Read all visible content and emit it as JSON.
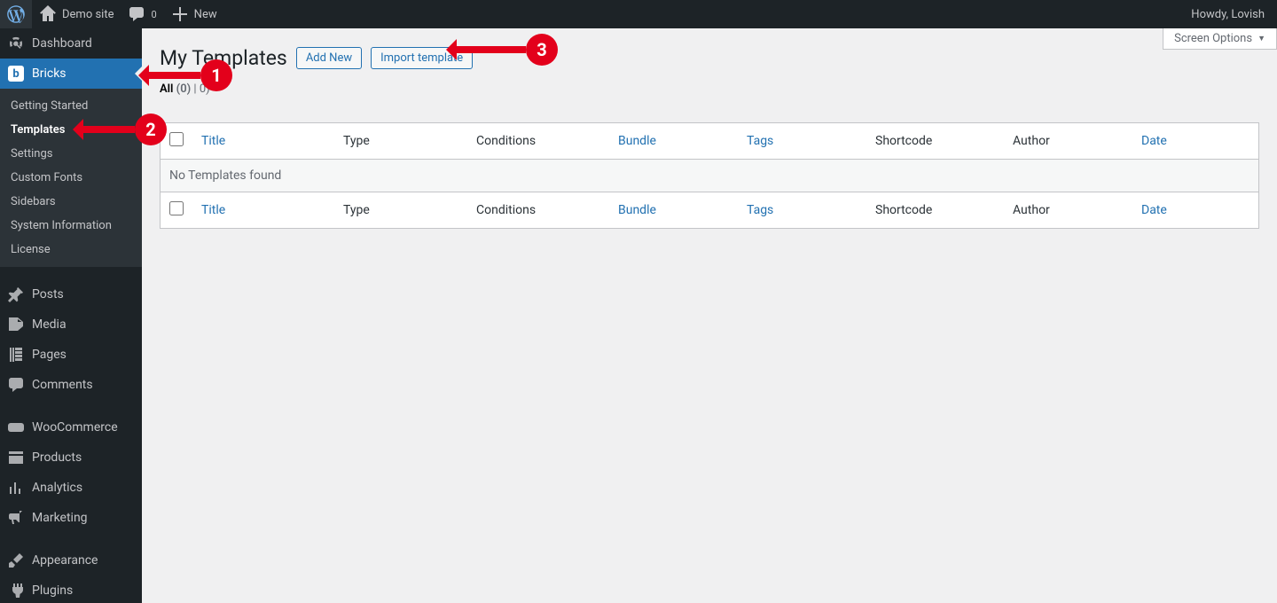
{
  "adminbar": {
    "site_name": "Demo site",
    "comments_count": "0",
    "new_label": "New",
    "howdy": "Howdy, Lovish"
  },
  "menu": {
    "dashboard": "Dashboard",
    "bricks": "Bricks",
    "submenu": {
      "getting_started": "Getting Started",
      "templates": "Templates",
      "settings": "Settings",
      "custom_fonts": "Custom Fonts",
      "sidebars": "Sidebars",
      "system_information": "System Information",
      "license": "License"
    },
    "posts": "Posts",
    "media": "Media",
    "pages": "Pages",
    "comments": "Comments",
    "woocommerce": "WooCommerce",
    "products": "Products",
    "analytics": "Analytics",
    "marketing": "Marketing",
    "appearance": "Appearance",
    "plugins": "Plugins"
  },
  "page": {
    "screen_options": "Screen Options",
    "title": "My Templates",
    "add_new": "Add New",
    "import_template": "Import template"
  },
  "filters": {
    "all_label": "All",
    "all_count": "(0)",
    "sep": " | ",
    "trash_count": "0)"
  },
  "columns": {
    "title": "Title",
    "type": "Type",
    "conditions": "Conditions",
    "bundle": "Bundle",
    "tags": "Tags",
    "shortcode": "Shortcode",
    "author": "Author",
    "date": "Date"
  },
  "table": {
    "no_items": "No Templates found"
  },
  "annotations": {
    "one": "1",
    "two": "2",
    "three": "3"
  }
}
